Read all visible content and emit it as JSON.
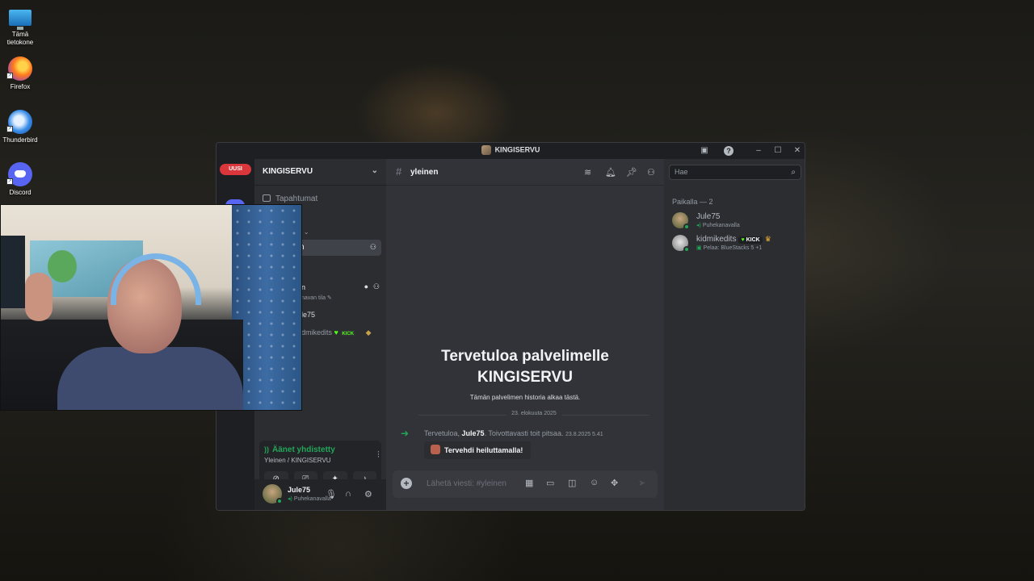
{
  "desktop": {
    "icons": [
      {
        "label": "Tämä tietokone",
        "icon": "monitor-icon"
      },
      {
        "label": "Firefox",
        "icon": "firefox-icon"
      },
      {
        "label": "Thunderbird",
        "icon": "thunderbird-icon"
      },
      {
        "label": "Discord",
        "icon": "discord-icon"
      }
    ]
  },
  "window": {
    "title": "KINGISERVU"
  },
  "guilds": {
    "new_badge": "UUSI"
  },
  "sidebar": {
    "server_name": "KINGISERVU",
    "events_label": "Tapahtumat",
    "category_text": "at",
    "selected_channel_fragment": "n",
    "voice_channel_fragment": "n",
    "voice_status_fragment": "navan tila",
    "voice_users": [
      "le75",
      "dmikedits"
    ],
    "kick_fragment": "KICK"
  },
  "voice_panel": {
    "status": "Äänet yhdistetty",
    "location": "Yleinen / KINGISERVU"
  },
  "user_panel": {
    "name": "Jule75",
    "status": "Puhekanavalla"
  },
  "chat": {
    "channel_name": "yleinen",
    "welcome_title_line1": "Tervetuloa palvelimelle",
    "welcome_title_line2": "KINGISERVU",
    "welcome_sub": "Tämän palvelimen historia alkaa tästä.",
    "date_divider": "23. elokuuta 2025",
    "join_message": {
      "prefix": "Tervetuloa, ",
      "user": "Jule75",
      "suffix": ". Toivottavasti toit pitsaa.",
      "timestamp": "23.8.2025 5.41"
    },
    "wave_button": "Tervehdi heiluttamalla!",
    "composer_placeholder": "Lähetä viesti: #yleinen"
  },
  "members": {
    "search_placeholder": "Hae",
    "header": "Paikalla — 2",
    "list": [
      {
        "name": "Jule75",
        "status": "Puhekanavalla"
      },
      {
        "name": "kidmikedits",
        "badge": "KICK",
        "status": "Pelaa: BlueStacks 5",
        "extra": "+1"
      }
    ]
  }
}
